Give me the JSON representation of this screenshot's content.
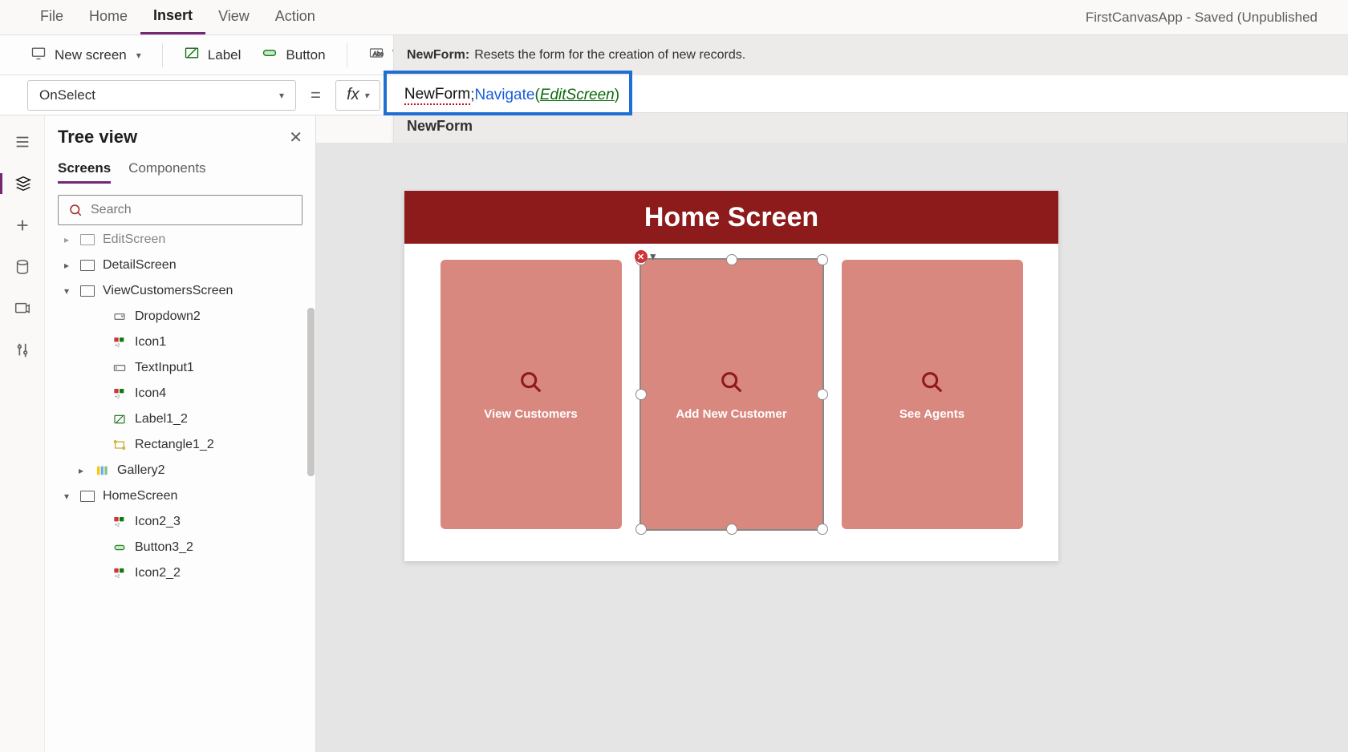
{
  "app_title": "FirstCanvasApp - Saved (Unpublished",
  "menu": {
    "file": "File",
    "home": "Home",
    "insert": "Insert",
    "view": "View",
    "action": "Action"
  },
  "ribbon": {
    "new_screen": "New screen",
    "label": "Label",
    "button": "Button",
    "text": "Text"
  },
  "tooltip": {
    "head": "NewForm:",
    "body": "Resets the form for the creation of new records."
  },
  "prop_bar": {
    "property": "OnSelect",
    "eq": "=",
    "fx": "fx"
  },
  "formula": {
    "newform": "NewForm",
    "semi": ";",
    "navigate": "Navigate",
    "lparen": "(",
    "editscreen": "EditScreen",
    "rparen": ")"
  },
  "intellisense": "NewForm",
  "tree": {
    "title": "Tree view",
    "tabs": {
      "screens": "Screens",
      "components": "Components"
    },
    "search_placeholder": "Search",
    "items": [
      {
        "label": "EditScreen",
        "kind": "screen",
        "caret": ">",
        "indent": 0,
        "cutoff": true
      },
      {
        "label": "DetailScreen",
        "kind": "screen",
        "caret": ">",
        "indent": 0
      },
      {
        "label": "ViewCustomersScreen",
        "kind": "screen",
        "caret": "v",
        "indent": 0
      },
      {
        "label": "Dropdown2",
        "kind": "dropdown",
        "indent": 2
      },
      {
        "label": "Icon1",
        "kind": "icon",
        "indent": 2
      },
      {
        "label": "TextInput1",
        "kind": "textinput",
        "indent": 2
      },
      {
        "label": "Icon4",
        "kind": "icon",
        "indent": 2
      },
      {
        "label": "Label1_2",
        "kind": "label",
        "indent": 2
      },
      {
        "label": "Rectangle1_2",
        "kind": "rect",
        "indent": 2
      },
      {
        "label": "Gallery2",
        "kind": "gallery",
        "caret": ">",
        "indent": 1
      },
      {
        "label": "HomeScreen",
        "kind": "screen",
        "caret": "v",
        "indent": 0
      },
      {
        "label": "Icon2_3",
        "kind": "icon",
        "indent": 2
      },
      {
        "label": "Button3_2",
        "kind": "button",
        "indent": 2
      },
      {
        "label": "Icon2_2",
        "kind": "icon",
        "indent": 2
      }
    ]
  },
  "canvas": {
    "header": "Home Screen",
    "cards": [
      {
        "label": "View Customers",
        "selected": false
      },
      {
        "label": "Add New Customer",
        "selected": true
      },
      {
        "label": "See Agents",
        "selected": false
      }
    ]
  }
}
